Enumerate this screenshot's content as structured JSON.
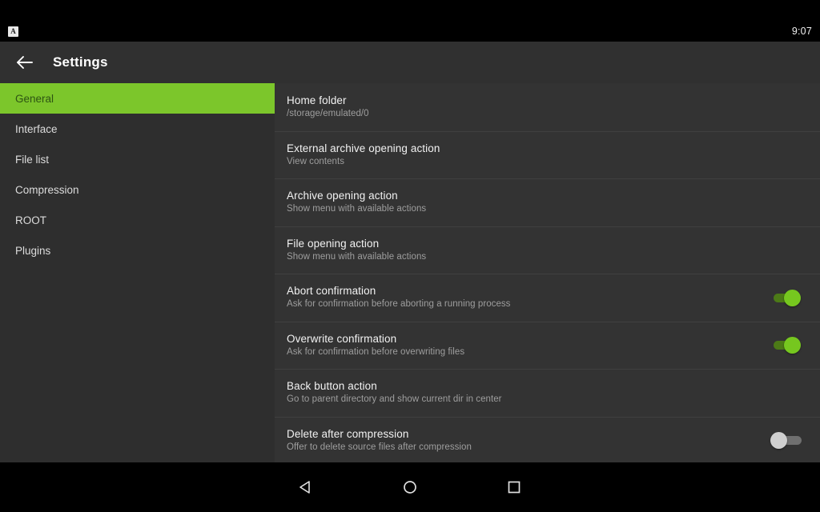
{
  "statusbar": {
    "notification_icon": "app-notification-icon",
    "notification_glyph": "A",
    "time": "9:07"
  },
  "toolbar": {
    "back_icon": "back-arrow-icon",
    "title": "Settings"
  },
  "sidebar": {
    "items": [
      {
        "label": "General",
        "selected": true
      },
      {
        "label": "Interface",
        "selected": false
      },
      {
        "label": "File list",
        "selected": false
      },
      {
        "label": "Compression",
        "selected": false
      },
      {
        "label": "ROOT",
        "selected": false
      },
      {
        "label": "Plugins",
        "selected": false
      }
    ]
  },
  "settings": {
    "rows": [
      {
        "title": "Home folder",
        "subtitle": "/storage/emulated/0",
        "control": "none"
      },
      {
        "title": "External archive opening action",
        "subtitle": "View contents",
        "control": "none"
      },
      {
        "title": "Archive opening action",
        "subtitle": "Show menu with available actions",
        "control": "none"
      },
      {
        "title": "File opening action",
        "subtitle": "Show menu with available actions",
        "control": "none"
      },
      {
        "title": "Abort confirmation",
        "subtitle": "Ask for confirmation before aborting a running process",
        "control": "toggle",
        "toggle_state": "on"
      },
      {
        "title": "Overwrite confirmation",
        "subtitle": "Ask for confirmation before overwriting files",
        "control": "toggle",
        "toggle_state": "on"
      },
      {
        "title": "Back button action",
        "subtitle": "Go to parent directory and show current dir in center",
        "control": "none"
      },
      {
        "title": "Delete after compression",
        "subtitle": "Offer to delete source files after compression",
        "control": "toggle",
        "toggle_state": "off"
      }
    ]
  },
  "navbar": {
    "back_label": "back-nav",
    "home_label": "home-nav",
    "recents_label": "recents-nav"
  },
  "colors": {
    "accent_green": "#7cc62b",
    "accent_green_text": "#2d5413",
    "toolbar_bg": "#303030",
    "sidebar_bg": "#2e2e2e",
    "list_bg": "#333333",
    "divider": "#404040",
    "title_text": "#f2f2f2",
    "sub_text": "#9e9e9e",
    "toggle_on_knob": "#76c71f",
    "toggle_on_track": "#4c7a17",
    "toggle_off_knob": "#cfcfcf",
    "toggle_off_track": "#6f6f6f"
  }
}
